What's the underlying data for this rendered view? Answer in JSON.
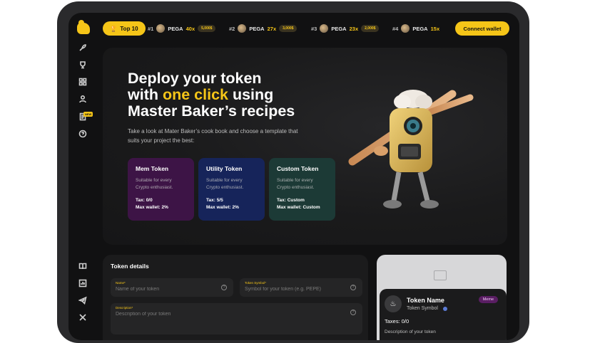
{
  "topbar": {
    "top10_label": "Top 10",
    "tickers": [
      {
        "rank": "#1",
        "name": "PEGA",
        "mult": "40x",
        "price": "5,000$"
      },
      {
        "rank": "#2",
        "name": "PEGA",
        "mult": "27x",
        "price": "3,000$"
      },
      {
        "rank": "#3",
        "name": "PEGA",
        "mult": "23x",
        "price": "2,000$"
      },
      {
        "rank": "#4",
        "name": "PEGA",
        "mult": "15x"
      }
    ],
    "connect_label": "Connect wallet"
  },
  "sidebar": {
    "icons": [
      "rocket-icon",
      "trophy-icon",
      "grid-icon",
      "user-icon",
      "document-icon",
      "help-icon",
      "book-icon",
      "chart-icon",
      "telegram-icon",
      "x-icon"
    ],
    "new_badge": "NEW"
  },
  "hero": {
    "title_line1": "Deploy your token",
    "title_pre": "with ",
    "title_accent": "one click",
    "title_post": " using",
    "title_line3": "Master Baker’s recipes",
    "subtitle": "Take a look at Mater Baker’s cook book and choose a template that suits your project the best:",
    "cards": [
      {
        "title": "Mem Token",
        "desc": "Suitable for every Crypto enthusiast.",
        "tax": "Tax: 0/0",
        "wallet": "Max wallet: 2%"
      },
      {
        "title": "Utility Token",
        "desc": "Suitable for every Crypto enthusiast.",
        "tax": "Tax: 5/5",
        "wallet": "Max wallet: 2%"
      },
      {
        "title": "Custom Token",
        "desc": "Suitable for every Crypto enthusiast.",
        "tax": "Tax: Custom",
        "wallet": "Max wallet: Custom"
      }
    ]
  },
  "details": {
    "title": "Token details",
    "name_label": "Name*",
    "name_placeholder": "Name of your token",
    "symbol_label": "Token Symbol*",
    "symbol_placeholder": "Symbol for your token (e.g. PEPE)",
    "desc_label": "Description*",
    "desc_placeholder": "Description of your token"
  },
  "preview": {
    "name": "Token Name",
    "symbol": "Token Symbol",
    "tag": "Meme",
    "taxes": "Taxes: 0/0",
    "description": "Description of your token"
  },
  "colors": {
    "accent": "#f5c518",
    "background": "#111112",
    "meme_card": "#3d1446",
    "utility_card": "#16245a",
    "custom_card": "#1c3a36"
  }
}
